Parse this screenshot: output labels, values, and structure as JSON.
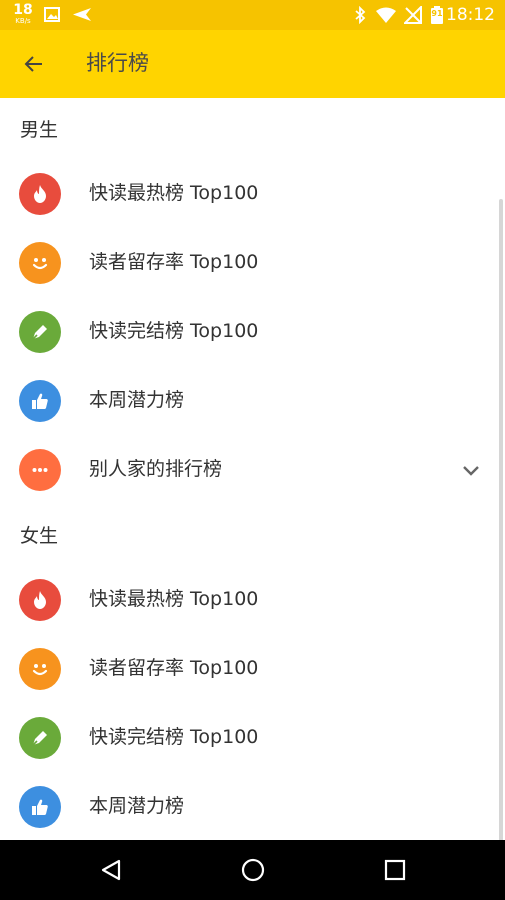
{
  "status_bar": {
    "speed_value": "18",
    "speed_unit": "KB/s",
    "time": "18:12",
    "battery_text": "91"
  },
  "app_bar": {
    "title": "排行榜"
  },
  "sections": [
    {
      "header": "男生",
      "items": [
        {
          "label": "快读最热榜 Top100",
          "icon": "flame-icon",
          "color": "#e84c3d"
        },
        {
          "label": "读者留存率 Top100",
          "icon": "smiley-icon",
          "color": "#f7931e"
        },
        {
          "label": "快读完结榜 Top100",
          "icon": "pen-icon",
          "color": "#6aaa3a"
        },
        {
          "label": "本周潜力榜",
          "icon": "thumbs-up-icon",
          "color": "#3d8fe0"
        },
        {
          "label": "别人家的排行榜",
          "icon": "more-icon",
          "color": "#ff6e40",
          "expandable": true
        }
      ]
    },
    {
      "header": "女生",
      "items": [
        {
          "label": "快读最热榜 Top100",
          "icon": "flame-icon",
          "color": "#e84c3d"
        },
        {
          "label": "读者留存率 Top100",
          "icon": "smiley-icon",
          "color": "#f7931e"
        },
        {
          "label": "快读完结榜 Top100",
          "icon": "pen-icon",
          "color": "#6aaa3a"
        },
        {
          "label": "本周潜力榜",
          "icon": "thumbs-up-icon",
          "color": "#3d8fe0"
        }
      ]
    }
  ],
  "colors": {
    "status_bar": "#f6c300",
    "app_bar": "#ffd400",
    "nav_bar": "#000000"
  }
}
